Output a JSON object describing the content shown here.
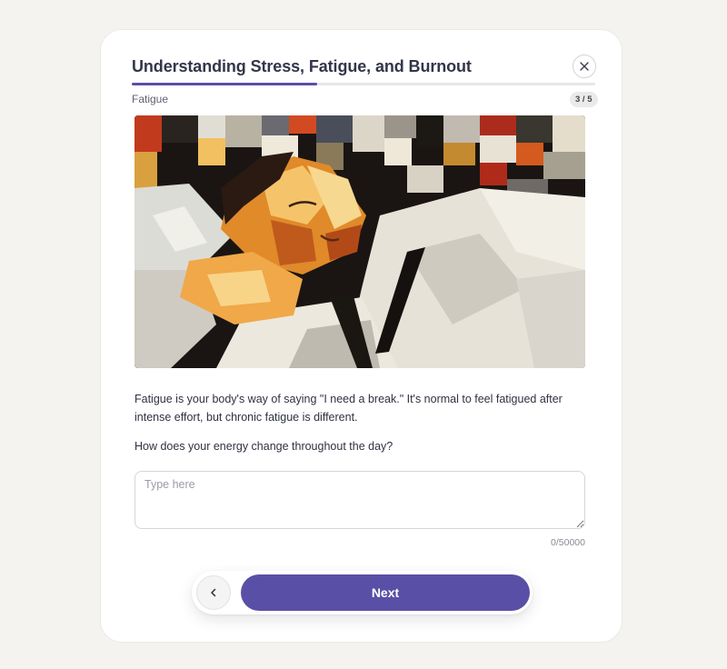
{
  "dialog": {
    "title": "Understanding Stress, Fatigue, and Burnout",
    "progress_fraction": 0.4,
    "section_label": "Fatigue",
    "step": "3 / 5"
  },
  "content": {
    "image_alt": "Cubist-style painting of a person sleeping",
    "paragraph": "Fatigue is your body's way of saying \"I need a break.\" It's normal to feel fatigued after intense effort, but chronic fatigue is different.",
    "question": "How does your energy change throughout the day?"
  },
  "answer": {
    "placeholder": "Type here",
    "value": "",
    "char_count": "0/50000"
  },
  "navigation": {
    "back_icon": "chevron-left-icon",
    "next_label": "Next"
  },
  "colors": {
    "accent": "#5a4fa6",
    "background": "#f4f3ef",
    "card": "#ffffff"
  }
}
